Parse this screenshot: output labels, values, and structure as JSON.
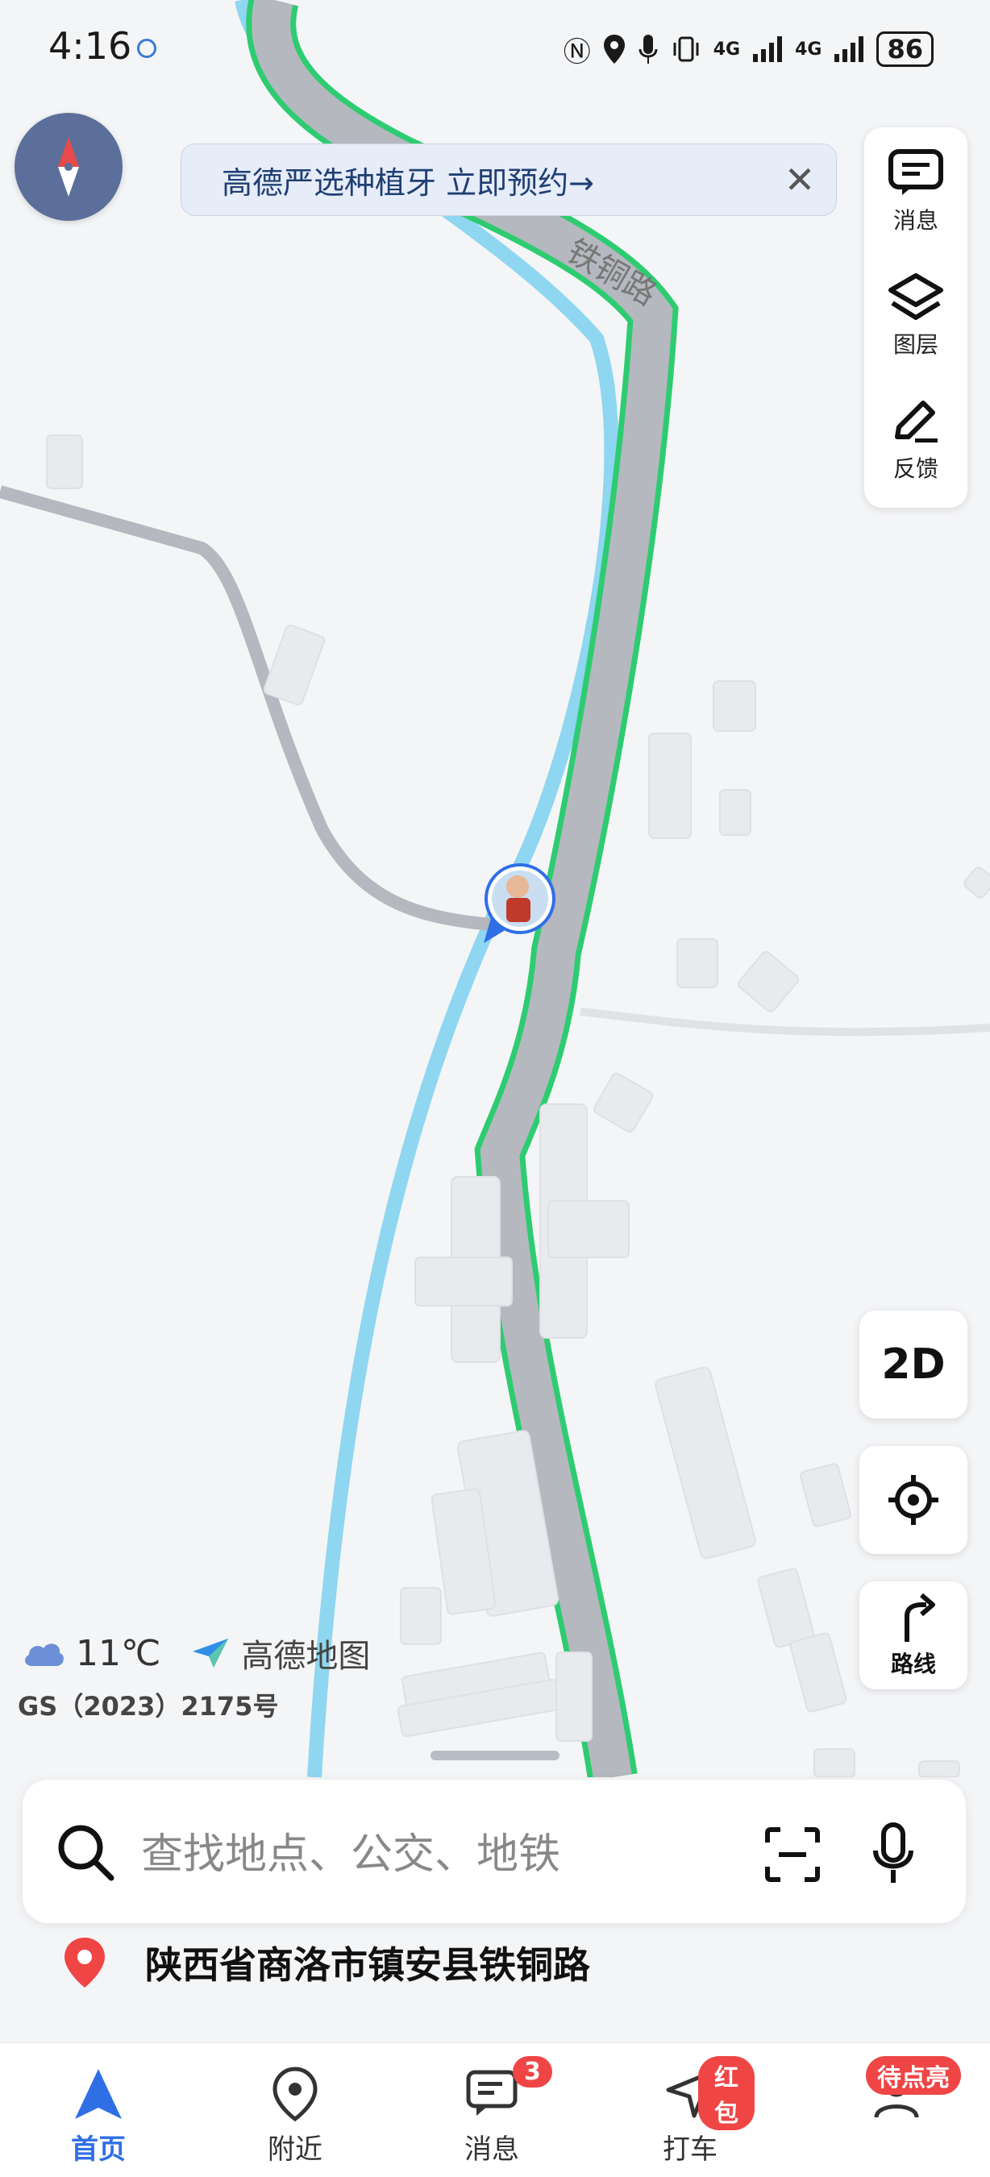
{
  "status_bar": {
    "time": "4:16",
    "battery": "86",
    "network": "4G"
  },
  "banner": {
    "text": "高德严选种植牙 立即预约→",
    "close": "✕"
  },
  "map": {
    "road_label": "铁铜路"
  },
  "right_panel": {
    "messages": "消息",
    "layers": "图层",
    "feedback": "反馈"
  },
  "map_controls": {
    "mode": "2D",
    "route": "路线"
  },
  "weather": {
    "temp": "11℃",
    "brand": "高德地图"
  },
  "license": "GS（2023）2175号",
  "search": {
    "placeholder": "查找地点、公交、地铁"
  },
  "location": {
    "address": "陕西省商洛市镇安县铁铜路"
  },
  "tabs": [
    {
      "label": "首页",
      "active": true
    },
    {
      "label": "附近"
    },
    {
      "label": "消息",
      "badge": "3"
    },
    {
      "label": "打车",
      "badge": "红包"
    },
    {
      "label": "",
      "badge": "待点亮"
    }
  ],
  "colors": {
    "accent": "#2f6fe6",
    "river": "#8fd6f0",
    "road": "#b5b8bf",
    "highlight": "#2ecc71",
    "badge": "#f04545"
  }
}
